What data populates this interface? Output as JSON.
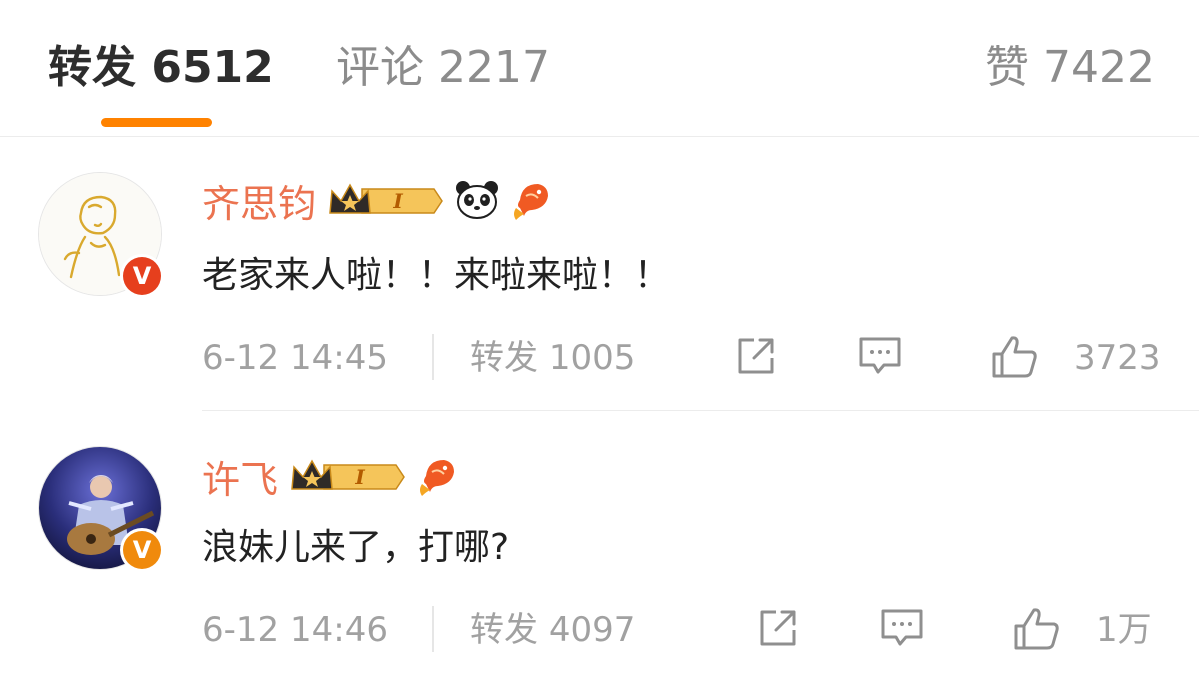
{
  "tabs": {
    "repost": {
      "label": "转发",
      "count": "6512"
    },
    "comment": {
      "label": "评论",
      "count": "2217"
    },
    "like": {
      "label": "赞",
      "count": "7422"
    }
  },
  "colors": {
    "accent": "#ff8200",
    "username": "#eb7350",
    "meta_text": "#a1a1a1",
    "verified_red": "#e63f1d",
    "verified_orange": "#f08a0c"
  },
  "comments": [
    {
      "username": "齐思钧",
      "verified_badge": "V",
      "badges": [
        "crown-level-icon",
        "panda-icon",
        "koi-fish-icon"
      ],
      "level_label": "I",
      "text": "老家来人啦！！来啦来啦！！",
      "time": "6-12 14:45",
      "repost_label": "转发",
      "repost_count": "1005",
      "likes": "3723"
    },
    {
      "username": "许飞",
      "verified_badge": "V",
      "badges": [
        "crown-level-icon",
        "koi-fish-icon"
      ],
      "level_label": "I",
      "text": "浪妹儿来了，打哪?",
      "time": "6-12 14:46",
      "repost_label": "转发",
      "repost_count": "4097",
      "likes": "1万"
    }
  ]
}
